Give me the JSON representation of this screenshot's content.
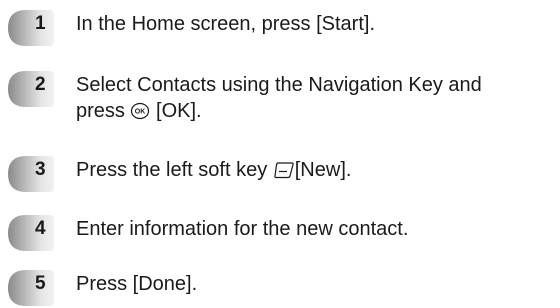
{
  "steps": [
    {
      "number": "1",
      "text": "In the Home screen, press [Start]."
    },
    {
      "number": "2",
      "text_line1": "Select Contacts using the Navigation Key and",
      "text_line2_prefix": "press ",
      "ok_icon": "ok-key-icon",
      "text_line2_suffix": " [OK]."
    },
    {
      "number": "3",
      "text_prefix": "Press the left soft key ",
      "softkey_icon": "left-soft-key-icon",
      "text_suffix": "[New]."
    },
    {
      "number": "4",
      "text": "Enter information for the new contact."
    },
    {
      "number": "5",
      "text": "Press [Done]."
    }
  ],
  "colors": {
    "badge_light": "#e6e6e6",
    "badge_dark": "#8a8a8a",
    "text": "#1a1a1a"
  }
}
